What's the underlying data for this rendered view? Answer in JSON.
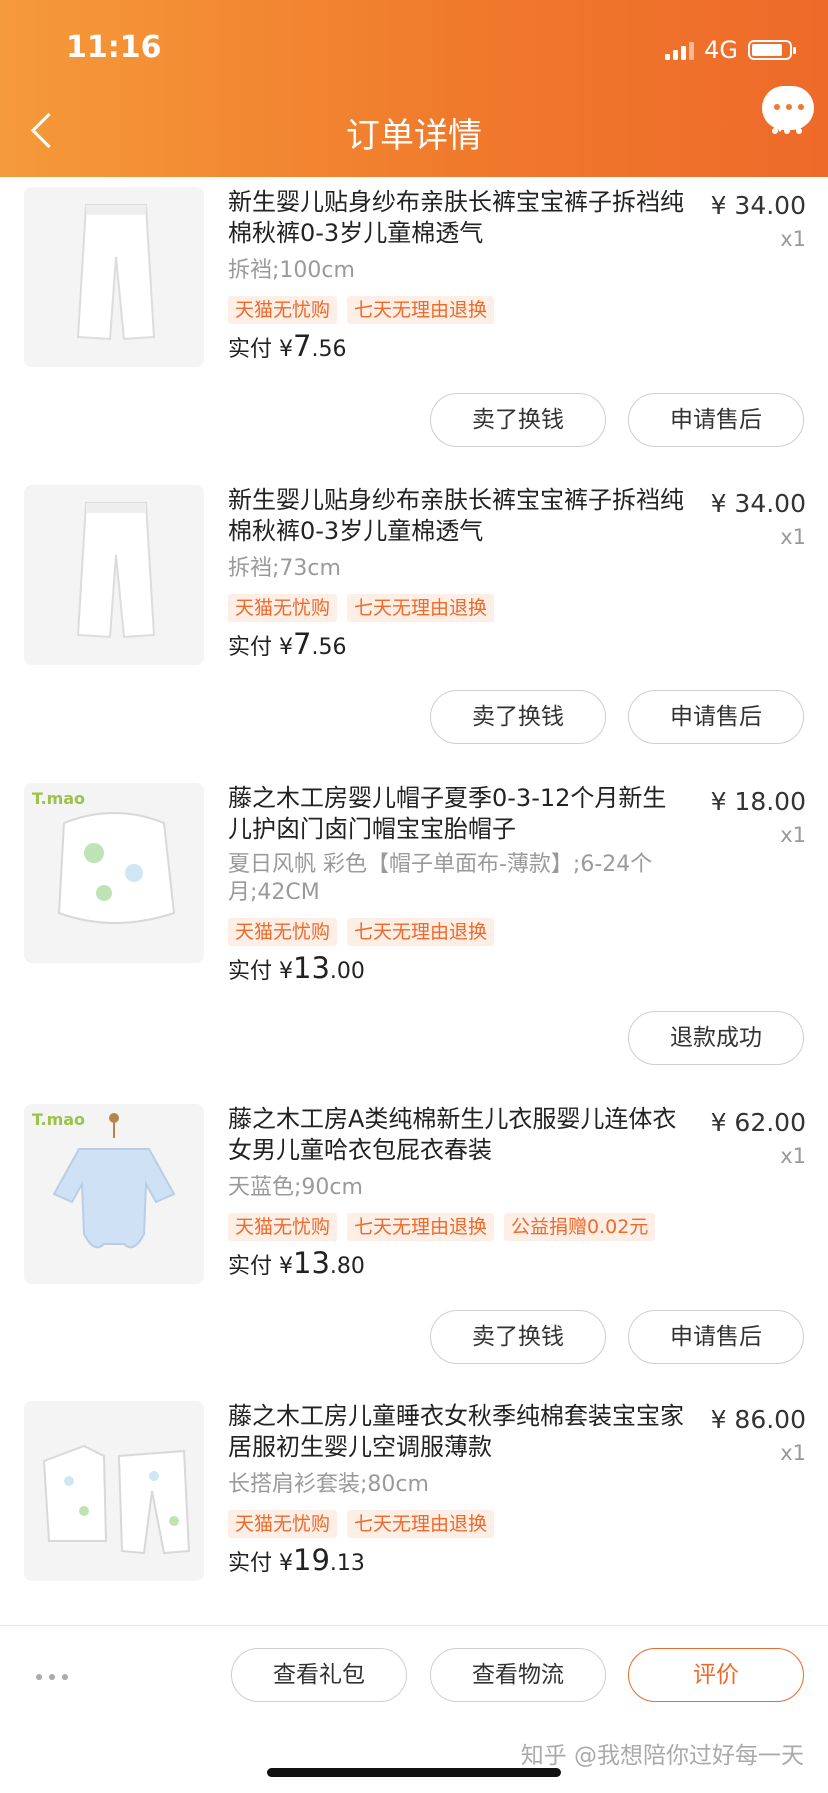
{
  "status": {
    "time": "11:16",
    "network": "4G"
  },
  "header": {
    "title": "订单详情"
  },
  "items": [
    {
      "title": "新生婴儿贴身纱布亲肤长裤宝宝裤子拆裆纯棉秋裤0-3岁儿童棉透气",
      "price": "¥ 34.00",
      "qty": "x1",
      "sku": "拆裆;100cm",
      "tags": [
        "天猫无忧购",
        "七天无理由退换"
      ],
      "paid_label": "实付",
      "paid_currency": "¥",
      "paid_int": "7",
      "paid_dec": ".56",
      "buttons": [
        "卖了换钱",
        "申请售后"
      ]
    },
    {
      "title": "新生婴儿贴身纱布亲肤长裤宝宝裤子拆裆纯棉秋裤0-3岁儿童棉透气",
      "price": "¥ 34.00",
      "qty": "x1",
      "sku": "拆裆;73cm",
      "tags": [
        "天猫无忧购",
        "七天无理由退换"
      ],
      "paid_label": "实付",
      "paid_currency": "¥",
      "paid_int": "7",
      "paid_dec": ".56",
      "buttons": [
        "卖了换钱",
        "申请售后"
      ]
    },
    {
      "title": "藤之木工房婴儿帽子夏季0-3-12个月新生儿护囟门卤门帽宝宝胎帽子",
      "price": "¥ 18.00",
      "qty": "x1",
      "sku": "夏日风帆 彩色【帽子单面布-薄款】;6-24个月;42CM",
      "tags": [
        "天猫无忧购",
        "七天无理由退换"
      ],
      "paid_label": "实付",
      "paid_currency": "¥",
      "paid_int": "13",
      "paid_dec": ".00",
      "buttons": [
        "退款成功"
      ],
      "brand": "T.mao"
    },
    {
      "title": "藤之木工房A类纯棉新生儿衣服婴儿连体衣女男儿童哈衣包屁衣春装",
      "price": "¥ 62.00",
      "qty": "x1",
      "sku": "天蓝色;90cm",
      "tags": [
        "天猫无忧购",
        "七天无理由退换",
        "公益捐赠0.02元"
      ],
      "paid_label": "实付",
      "paid_currency": "¥",
      "paid_int": "13",
      "paid_dec": ".80",
      "buttons": [
        "卖了换钱",
        "申请售后"
      ],
      "brand": "T.mao"
    },
    {
      "title": "藤之木工房儿童睡衣女秋季纯棉套装宝宝家居服初生婴儿空调服薄款",
      "price": "¥ 86.00",
      "qty": "x1",
      "sku": "长搭肩衫套装;80cm",
      "tags": [
        "天猫无忧购",
        "七天无理由退换"
      ],
      "paid_label": "实付",
      "paid_currency": "¥",
      "paid_int": "19",
      "paid_dec": ".13"
    }
  ],
  "bottom_bar": {
    "buttons": [
      "查看礼包",
      "查看物流",
      "评价"
    ],
    "watermark": "知乎 @我想陪你过好每一天"
  },
  "colors": {
    "accent": "#ee6a2a",
    "header_start": "#f59a3a",
    "header_end": "#ee6a2a"
  }
}
